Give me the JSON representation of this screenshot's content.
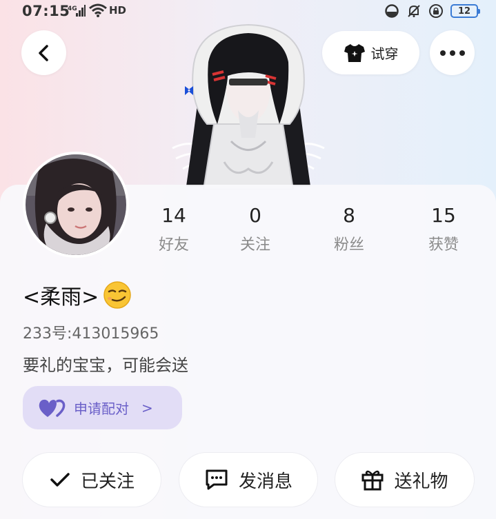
{
  "status_bar": {
    "time": "07:15",
    "network": "4G",
    "hd": "HD",
    "battery": "12"
  },
  "header": {
    "tryon_label": "试穿"
  },
  "profile": {
    "nickname": "<柔雨>",
    "uid": "233号:413015965",
    "bio": "要礼的宝宝，可能会送",
    "pair_label": "申请配对",
    "pair_arrow": ">"
  },
  "stats": [
    {
      "value": "14",
      "label": "好友"
    },
    {
      "value": "0",
      "label": "关注"
    },
    {
      "value": "8",
      "label": "粉丝"
    },
    {
      "value": "15",
      "label": "获赞"
    }
  ],
  "actions": {
    "followed_label": "已关注",
    "message_label": "发消息",
    "gift_label": "送礼物"
  },
  "colors": {
    "pair_bg": "#e2ddf6",
    "pair_accent": "#6a5fc8",
    "battery_border": "#3a7bd5"
  },
  "icons": [
    "back-arrow-icon",
    "tshirt-icon",
    "more-dots-icon",
    "heart-pair-icon",
    "check-icon",
    "chat-bubble-icon",
    "gift-icon"
  ]
}
